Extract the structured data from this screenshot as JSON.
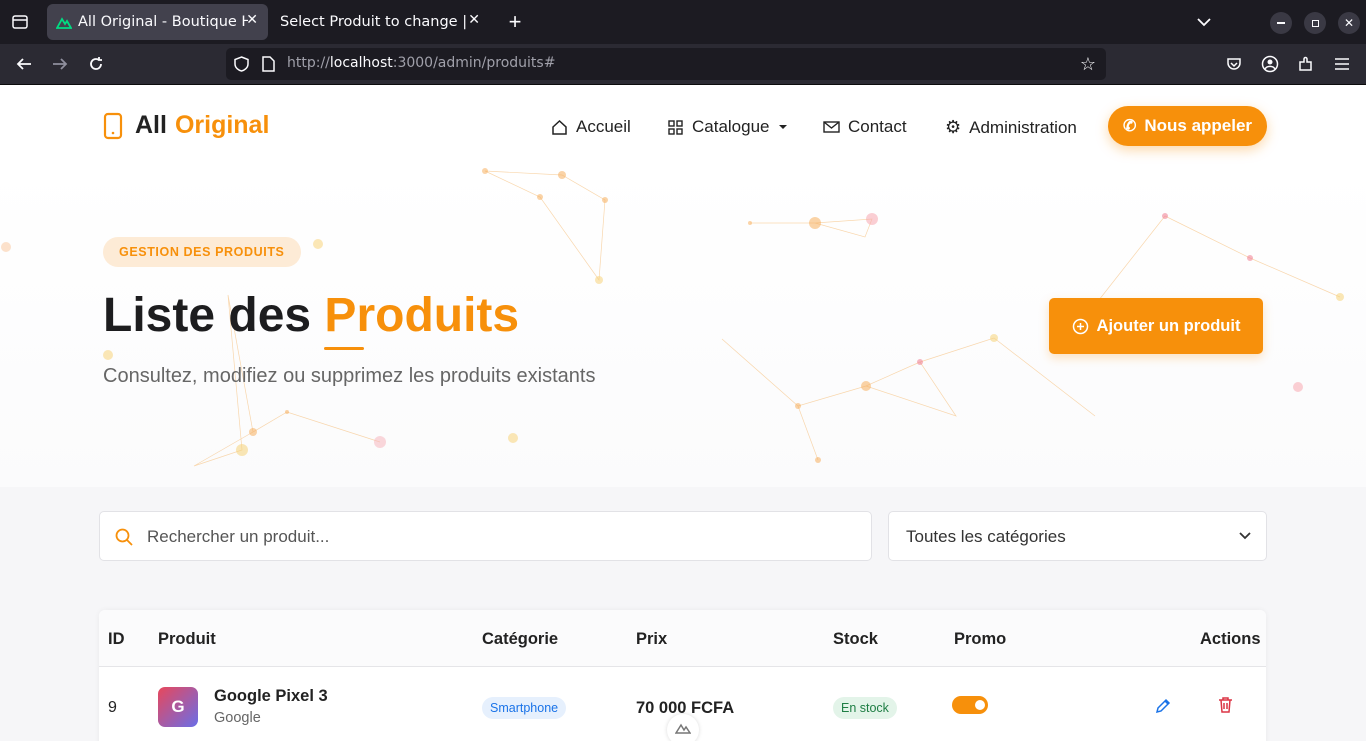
{
  "browser": {
    "tabs": [
      {
        "title": "All Original - Boutique Hig",
        "active": true
      },
      {
        "title": "Select Produit to change | Dj",
        "active": false
      }
    ],
    "url": {
      "scheme": "http://",
      "host": "localhost",
      "rest": ":3000/admin/produits#"
    }
  },
  "header": {
    "logo_a": "All",
    "logo_b": "Original",
    "nav": [
      "Accueil",
      "Catalogue",
      "Contact",
      "Administration"
    ],
    "call_label": "Nous appeler"
  },
  "hero": {
    "badge": "GESTION DES PRODUITS",
    "title_a": "Liste des",
    "title_b": "Produits",
    "subtitle": "Consultez, modifiez ou supprimez les produits existants",
    "add_label": "Ajouter un produit"
  },
  "filters": {
    "search_placeholder": "Rechercher un produit...",
    "category_value": "Toutes les catégories"
  },
  "table": {
    "headers": [
      "ID",
      "Produit",
      "Catégorie",
      "Prix",
      "Stock",
      "Promo",
      "Actions"
    ],
    "rows": [
      {
        "id": "9",
        "initial": "G",
        "name": "Google Pixel 3",
        "brand": "Google",
        "category": "Smartphone",
        "price": "70 000 FCFA",
        "stock": "En stock",
        "promo": true
      }
    ]
  },
  "colors": {
    "accent": "#f7900b",
    "badge_blue": "#1a73e8",
    "stock_green": "#1e7e44",
    "delete_red": "#dc3545"
  }
}
